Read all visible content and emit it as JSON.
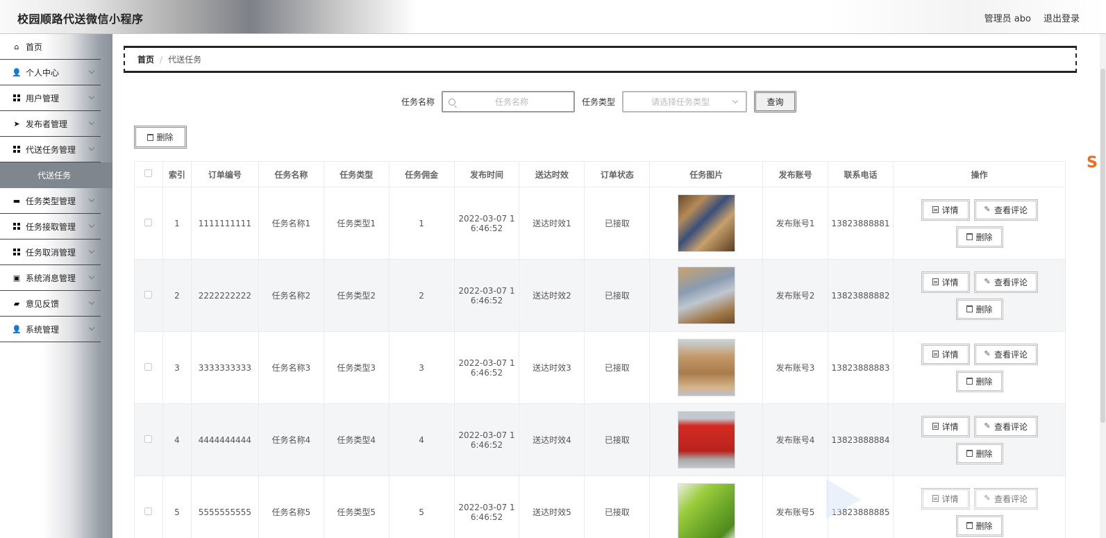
{
  "header": {
    "app_title": "校园顺路代送微信小程序",
    "admin_label": "管理员 abo",
    "logout_label": "退出登录"
  },
  "sidebar": {
    "items": [
      {
        "label": "首页",
        "icon": "home-icon",
        "expandable": false
      },
      {
        "label": "个人中心",
        "icon": "user-icon",
        "expandable": true
      },
      {
        "label": "用户管理",
        "icon": "grid-icon",
        "expandable": true
      },
      {
        "label": "发布者管理",
        "icon": "send-icon",
        "expandable": true
      },
      {
        "label": "代送任务管理",
        "icon": "grid-icon",
        "expandable": true,
        "expanded": true
      }
    ],
    "active_sub": "代送任务",
    "items_after": [
      {
        "label": "任务类型管理",
        "icon": "chat-icon"
      },
      {
        "label": "任务接取管理",
        "icon": "grid-icon"
      },
      {
        "label": "任务取消管理",
        "icon": "grid-icon"
      },
      {
        "label": "系统消息管理",
        "icon": "clipboard-icon"
      },
      {
        "label": "意见反馈",
        "icon": "briefcase-icon"
      },
      {
        "label": "系统管理",
        "icon": "user-icon"
      }
    ]
  },
  "breadcrumb": {
    "home": "首页",
    "separator": "/",
    "current": "代送任务"
  },
  "search": {
    "name_label": "任务名称",
    "name_placeholder": "任务名称",
    "type_label": "任务类型",
    "type_placeholder": "请选择任务类型",
    "query_button": "查询"
  },
  "toolbar": {
    "delete_label": "删除"
  },
  "table": {
    "columns": [
      "索引",
      "订单编号",
      "任务名称",
      "任务类型",
      "任务佣金",
      "发布时间",
      "送达时效",
      "订单状态",
      "任务图片",
      "发布账号",
      "联系电话",
      "操作"
    ],
    "rows": [
      {
        "index": "1",
        "order_no": "1111111111",
        "name": "任务名称1",
        "type": "任务类型1",
        "fee": "1",
        "time_line1": "2022-03-07 1",
        "time_line2": "6:46:52",
        "delivery": "送达时效1",
        "status": "已接取",
        "account": "发布账号1",
        "phone": "13823888881"
      },
      {
        "index": "2",
        "order_no": "2222222222",
        "name": "任务名称2",
        "type": "任务类型2",
        "fee": "2",
        "time_line1": "2022-03-07 1",
        "time_line2": "6:46:52",
        "delivery": "送达时效2",
        "status": "已接取",
        "account": "发布账号2",
        "phone": "13823888882"
      },
      {
        "index": "3",
        "order_no": "3333333333",
        "name": "任务名称3",
        "type": "任务类型3",
        "fee": "3",
        "time_line1": "2022-03-07 1",
        "time_line2": "6:46:52",
        "delivery": "送达时效3",
        "status": "已接取",
        "account": "发布账号3",
        "phone": "13823888883"
      },
      {
        "index": "4",
        "order_no": "4444444444",
        "name": "任务名称4",
        "type": "任务类型4",
        "fee": "4",
        "time_line1": "2022-03-07 1",
        "time_line2": "6:46:52",
        "delivery": "送达时效4",
        "status": "已接取",
        "account": "发布账号4",
        "phone": "13823888884"
      },
      {
        "index": "5",
        "order_no": "5555555555",
        "name": "任务名称5",
        "type": "任务类型5",
        "fee": "5",
        "time_line1": "2022-03-07 1",
        "time_line2": "6:46:52",
        "delivery": "送达时效5",
        "status": "已接取",
        "account": "发布账号5",
        "phone": "13823888885"
      }
    ],
    "actions": {
      "detail": "详情",
      "review": "查看评论",
      "delete": "删除"
    }
  }
}
